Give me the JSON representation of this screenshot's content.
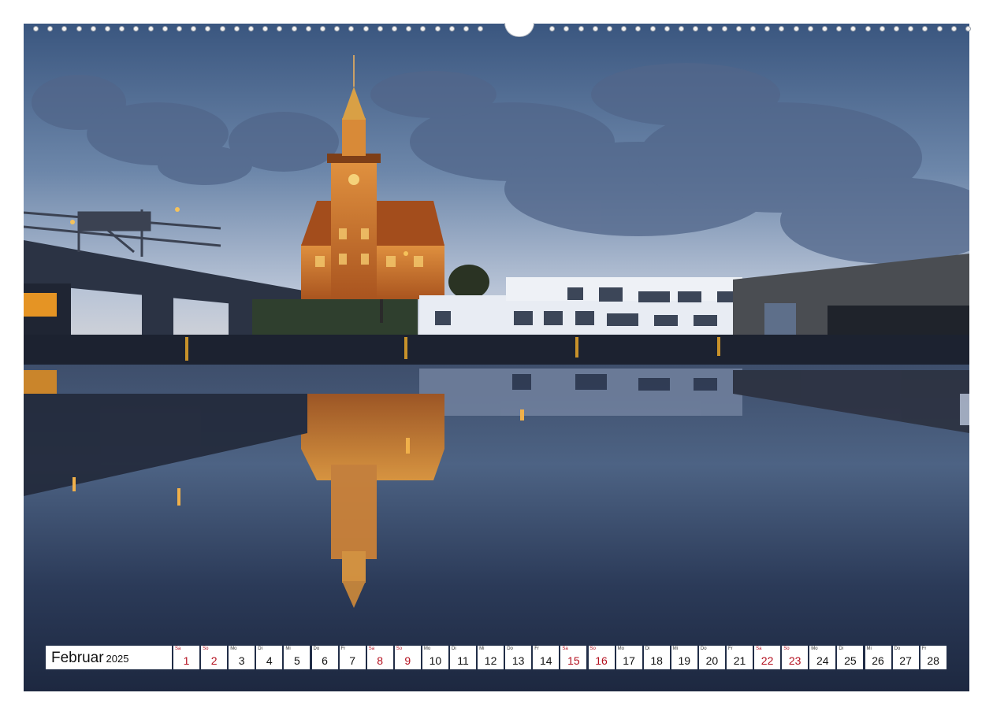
{
  "calendar": {
    "month": "Februar",
    "year": "2025",
    "days": [
      {
        "dow": "Sa",
        "num": "1",
        "weekend": true
      },
      {
        "dow": "So",
        "num": "2",
        "weekend": true
      },
      {
        "dow": "Mo",
        "num": "3",
        "weekend": false
      },
      {
        "dow": "Di",
        "num": "4",
        "weekend": false
      },
      {
        "dow": "Mi",
        "num": "5",
        "weekend": false
      },
      {
        "dow": "Do",
        "num": "6",
        "weekend": false
      },
      {
        "dow": "Fr",
        "num": "7",
        "weekend": false
      },
      {
        "dow": "Sa",
        "num": "8",
        "weekend": true
      },
      {
        "dow": "So",
        "num": "9",
        "weekend": true
      },
      {
        "dow": "Mo",
        "num": "10",
        "weekend": false
      },
      {
        "dow": "Di",
        "num": "11",
        "weekend": false
      },
      {
        "dow": "Mi",
        "num": "12",
        "weekend": false
      },
      {
        "dow": "Do",
        "num": "13",
        "weekend": false
      },
      {
        "dow": "Fr",
        "num": "14",
        "weekend": false
      },
      {
        "dow": "Sa",
        "num": "15",
        "weekend": true
      },
      {
        "dow": "So",
        "num": "16",
        "weekend": true
      },
      {
        "dow": "Mo",
        "num": "17",
        "weekend": false
      },
      {
        "dow": "Di",
        "num": "18",
        "weekend": false
      },
      {
        "dow": "Mi",
        "num": "19",
        "weekend": false
      },
      {
        "dow": "Do",
        "num": "20",
        "weekend": false
      },
      {
        "dow": "Fr",
        "num": "21",
        "weekend": false
      },
      {
        "dow": "Sa",
        "num": "22",
        "weekend": true
      },
      {
        "dow": "So",
        "num": "23",
        "weekend": true
      },
      {
        "dow": "Mo",
        "num": "24",
        "weekend": false
      },
      {
        "dow": "Di",
        "num": "25",
        "weekend": false
      },
      {
        "dow": "Mi",
        "num": "26",
        "weekend": false
      },
      {
        "dow": "Do",
        "num": "27",
        "weekend": false
      },
      {
        "dow": "Fr",
        "num": "28",
        "weekend": false
      }
    ]
  },
  "colors": {
    "weekend_text": "#b40f1e",
    "sky_top": "#3d5a86",
    "sky_horizon": "#c9cfdc",
    "water": "#23304a",
    "tower_lit": "#c9722c"
  },
  "photo": {
    "subject": "harbour-office-building-at-dusk-with-reflection",
    "icons": [
      "clock-tower",
      "bridge",
      "crane",
      "warehouse",
      "street-lamp"
    ]
  }
}
